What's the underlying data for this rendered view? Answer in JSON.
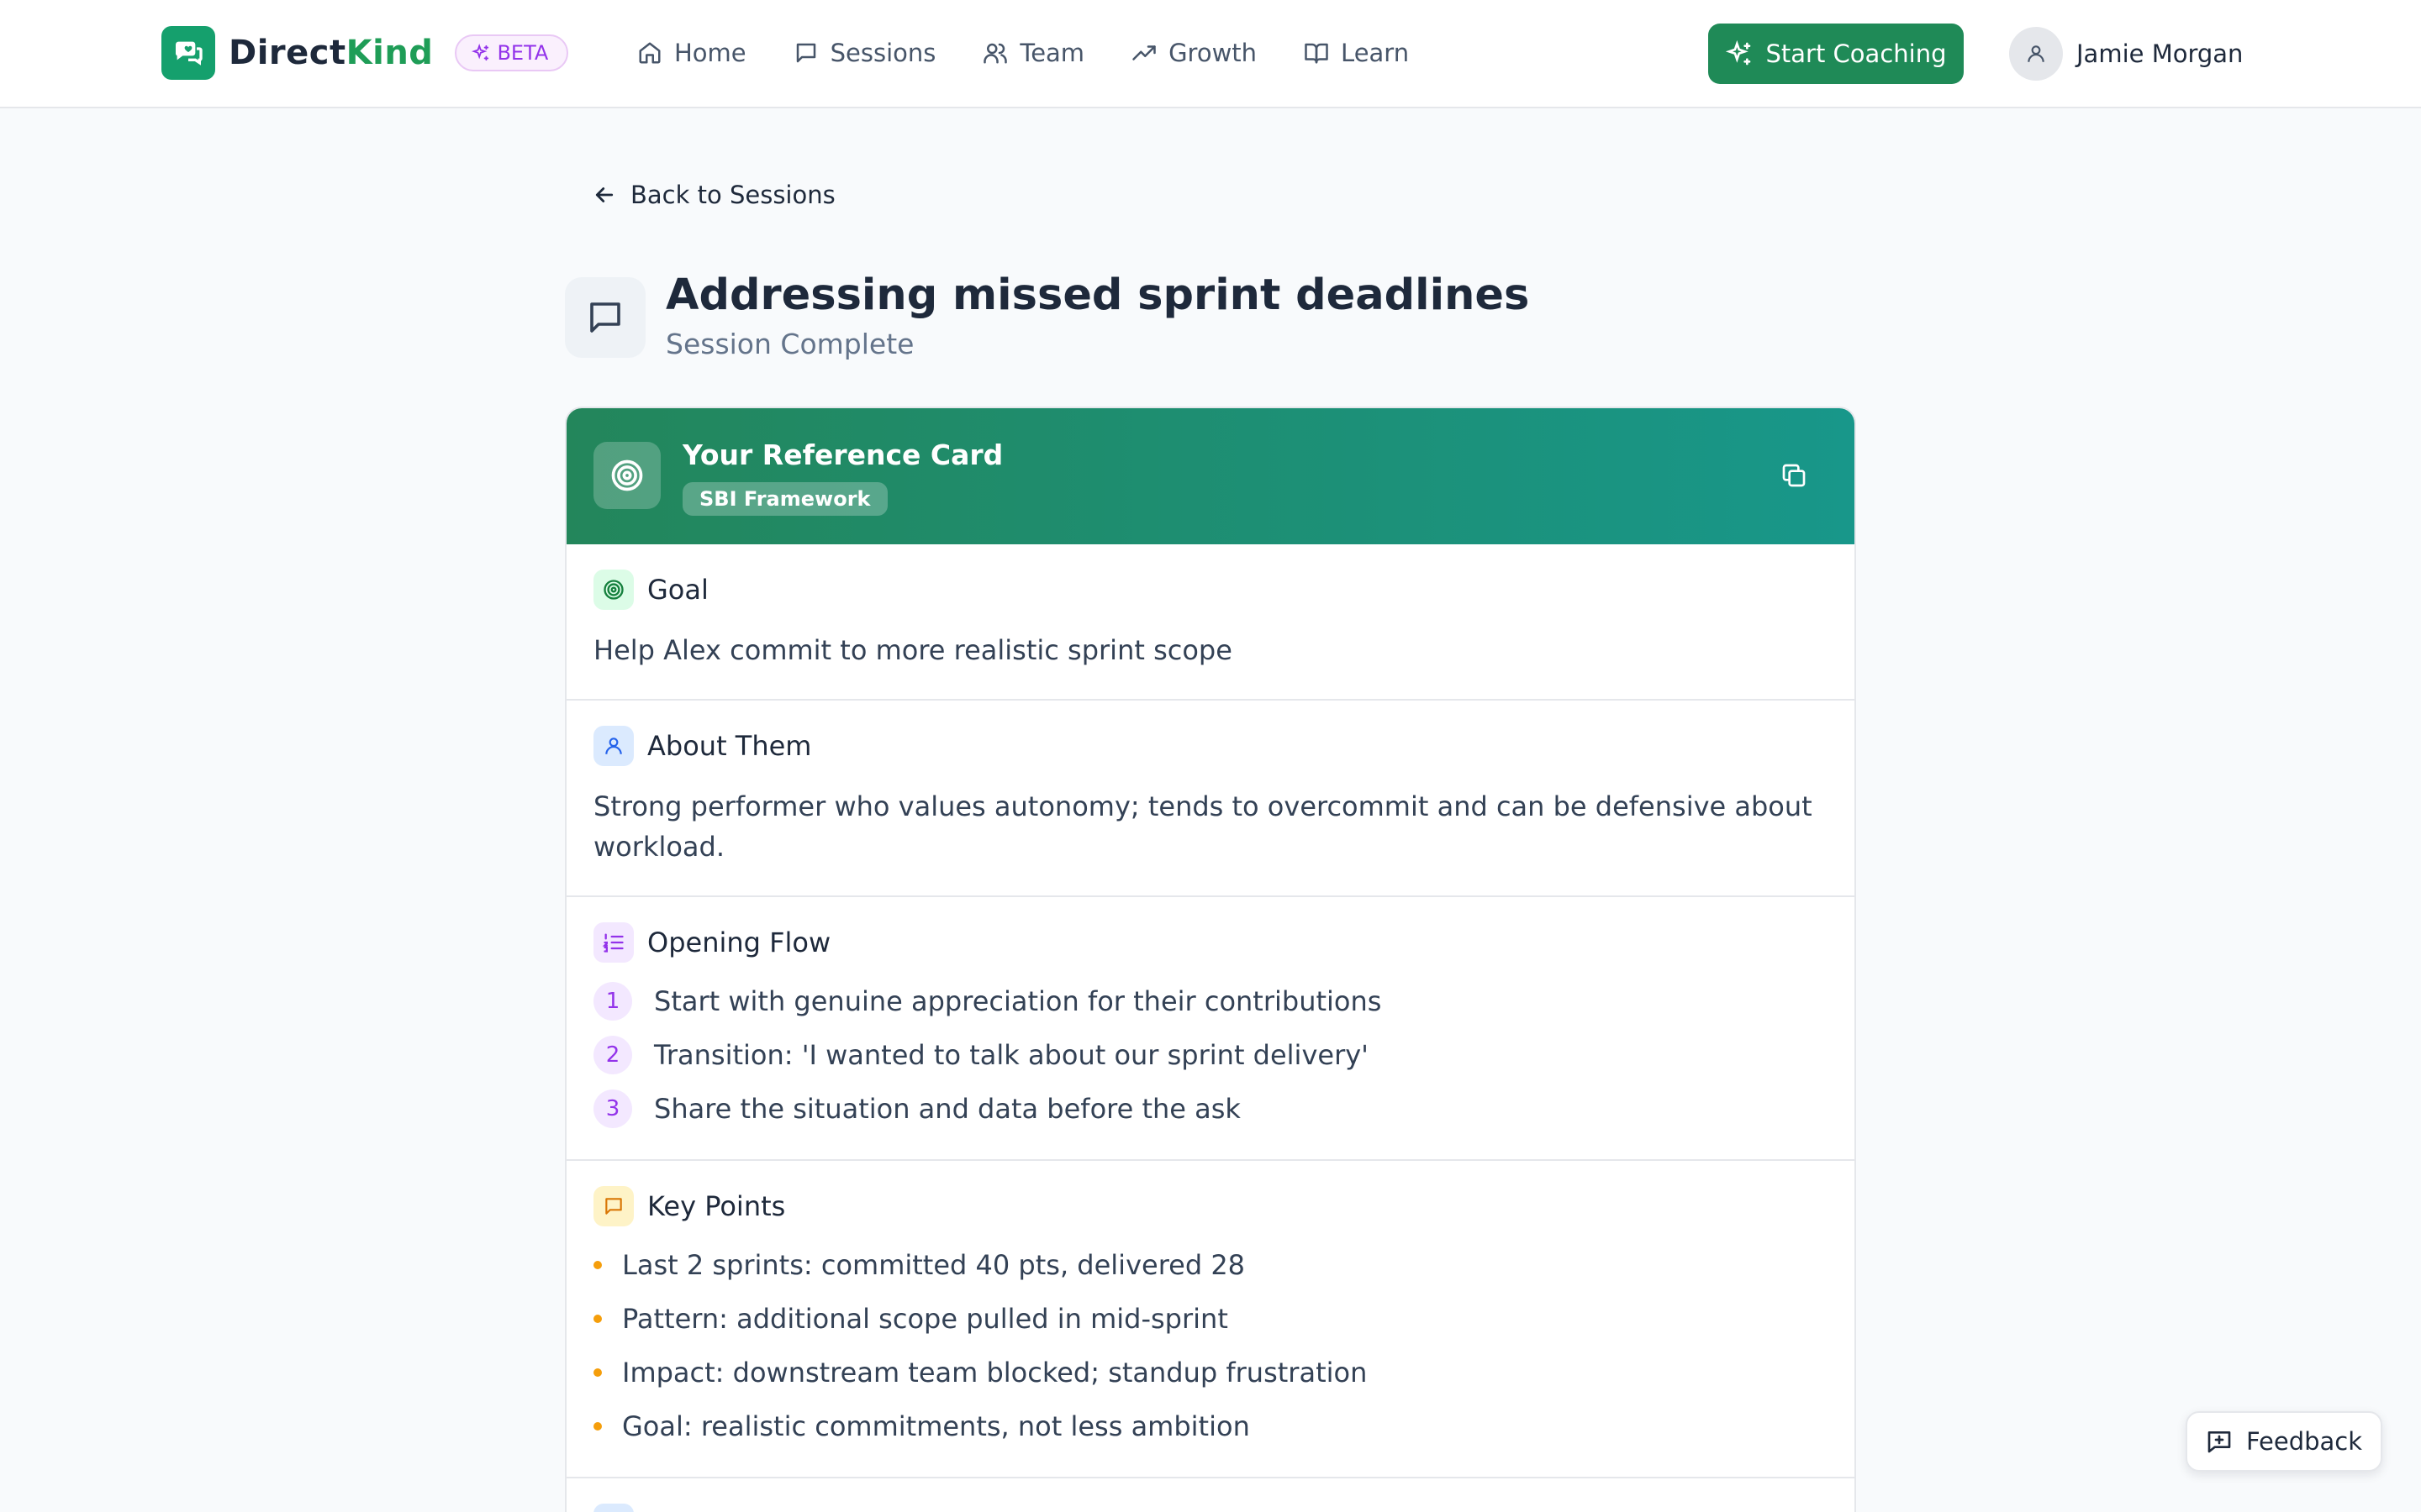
{
  "brand": {
    "name_part1": "Direct",
    "name_part2": "Kind",
    "badge": "BETA"
  },
  "nav": [
    {
      "label": "Home",
      "icon": "home-icon"
    },
    {
      "label": "Sessions",
      "icon": "chat-icon"
    },
    {
      "label": "Team",
      "icon": "users-icon"
    },
    {
      "label": "Growth",
      "icon": "trending-up-icon"
    },
    {
      "label": "Learn",
      "icon": "book-icon"
    }
  ],
  "header": {
    "cta_label": "Start Coaching",
    "user_name": "Jamie Morgan"
  },
  "page": {
    "back_label": "Back to Sessions",
    "title": "Addressing missed sprint deadlines",
    "status": "Session Complete"
  },
  "card": {
    "title": "Your Reference Card",
    "framework": "SBI Framework",
    "goal": {
      "heading": "Goal",
      "text": "Help Alex commit to more realistic sprint scope"
    },
    "about": {
      "heading": "About Them",
      "text": "Strong performer who values autonomy; tends to overcommit and can be defensive about workload."
    },
    "opening_flow": {
      "heading": "Opening Flow",
      "steps": [
        {
          "num": "1",
          "text": "Start with genuine appreciation for their contributions"
        },
        {
          "num": "2",
          "text": "Transition: 'I wanted to talk about our sprint delivery'"
        },
        {
          "num": "3",
          "text": "Share the situation and data before the ask"
        }
      ]
    },
    "key_points": {
      "heading": "Key Points",
      "items": [
        "Last 2 sprints: committed 40 pts, delivered 28",
        "Pattern: additional scope pulled in mid-sprint",
        "Impact: downstream team blocked; standup frustration",
        "Goal: realistic commitments, not less ambition"
      ]
    }
  },
  "feedback_label": "Feedback",
  "colors": {
    "brand_green": "#1f8a57",
    "beta_purple": "#9333ea",
    "bullet_amber": "#f59e0b",
    "card_header_start": "#23865b",
    "card_header_end": "#18978a"
  }
}
